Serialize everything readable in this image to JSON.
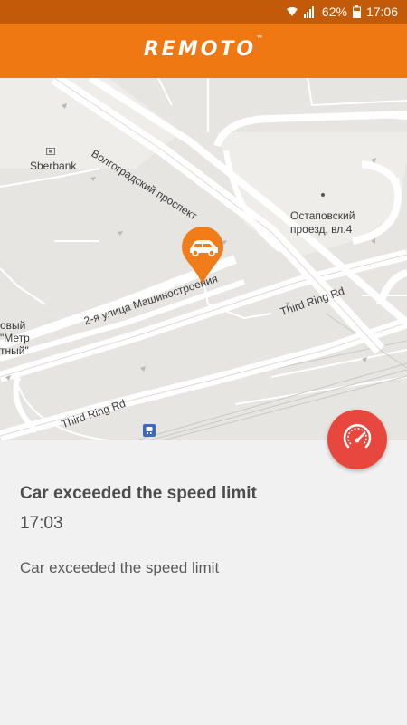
{
  "status_bar": {
    "battery_percent": "62%",
    "time": "17:06",
    "icons": [
      "wifi-icon",
      "signal-icon",
      "battery-icon"
    ]
  },
  "app_bar": {
    "logo_text": "REMOTO",
    "trademark": "™"
  },
  "map": {
    "labels": {
      "sberbank": "Sberbank",
      "volgogradsky": "Волгоградский проспект",
      "ostapovsky_line1": "Остаповский",
      "ostapovsky_line2": "проезд, вл.4",
      "mashinostroeniya": "2-я улица Машиностроения",
      "third_ring_right": "Third Ring Rd",
      "third_ring_left": "Third Ring Rd",
      "left_line1": "овый",
      "left_line2": "\"Метр",
      "left_line3": "тный\""
    },
    "icons": [
      "bank-icon",
      "car-marker-icon",
      "train-station-icon"
    ]
  },
  "event": {
    "title": "Car exceeded the speed limit",
    "time": "17:03",
    "description": "Car exceeded the speed limit",
    "icon": "speedometer-icon"
  },
  "colors": {
    "status_bar": "#c25a07",
    "app_bar": "#ef7813",
    "marker": "#f07d1a",
    "fab": "#e8473d",
    "map_bg": "#e6e5e2",
    "panel_bg": "#f1f1f1"
  }
}
